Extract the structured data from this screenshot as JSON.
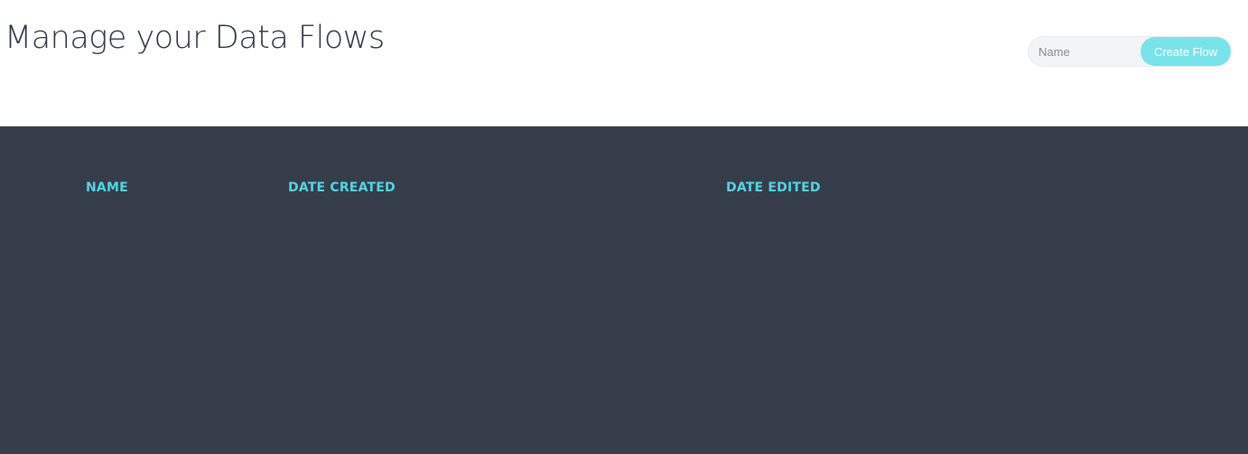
{
  "header": {
    "title": "Manage your Data Flows"
  },
  "create_form": {
    "name_placeholder": "Name",
    "name_value": "",
    "create_button_label": "Create Flow"
  },
  "flows_table": {
    "columns": [
      "NAME",
      "DATE CREATED",
      "DATE EDITED"
    ],
    "rows": []
  },
  "colors": {
    "accent": "#4fd8e2",
    "button": "#79e3ea",
    "table_background": "#343d49",
    "title_text": "#2b3440"
  }
}
